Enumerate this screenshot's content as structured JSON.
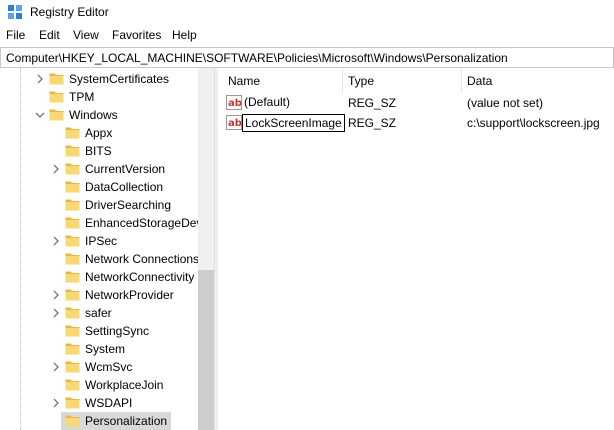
{
  "window": {
    "title": "Registry Editor",
    "app_icon": "registry-editor-icon"
  },
  "menu": [
    "File",
    "Edit",
    "View",
    "Favorites",
    "Help"
  ],
  "address": {
    "path": "Computer\\HKEY_LOCAL_MACHINE\\SOFTWARE\\Policies\\Microsoft\\Windows\\Personalization"
  },
  "tree": {
    "items": [
      {
        "label": "SystemCertificates",
        "expander": "collapsed"
      },
      {
        "label": "TPM",
        "expander": "none"
      },
      {
        "label": "Windows",
        "expander": "expanded"
      },
      {
        "label": "Appx",
        "expander": "none"
      },
      {
        "label": "BITS",
        "expander": "none"
      },
      {
        "label": "CurrentVersion",
        "expander": "collapsed"
      },
      {
        "label": "DataCollection",
        "expander": "none"
      },
      {
        "label": "DriverSearching",
        "expander": "none"
      },
      {
        "label": "EnhancedStorageDev",
        "expander": "none"
      },
      {
        "label": "IPSec",
        "expander": "collapsed"
      },
      {
        "label": "Network Connections",
        "expander": "none"
      },
      {
        "label": "NetworkConnectivity",
        "expander": "none"
      },
      {
        "label": "NetworkProvider",
        "expander": "collapsed"
      },
      {
        "label": "safer",
        "expander": "collapsed"
      },
      {
        "label": "SettingSync",
        "expander": "none"
      },
      {
        "label": "System",
        "expander": "none"
      },
      {
        "label": "WcmSvc",
        "expander": "collapsed"
      },
      {
        "label": "WorkplaceJoin",
        "expander": "none"
      },
      {
        "label": "WSDAPI",
        "expander": "collapsed"
      },
      {
        "label": "Personalization",
        "expander": "none",
        "selected": true
      }
    ]
  },
  "list": {
    "columns": {
      "name": "Name",
      "type": "Type",
      "data": "Data"
    },
    "rows": [
      {
        "name": "(Default)",
        "type": "REG_SZ",
        "data": "(value not set)",
        "icon": "string-value-icon"
      },
      {
        "name": "LockScreenImage",
        "type": "REG_SZ",
        "data": "c:\\support\\lockscreen.jpg",
        "icon": "string-value-icon",
        "focused": true
      }
    ]
  },
  "colors": {
    "folder": "#f8d775",
    "folder_dark": "#e3b844",
    "selection": "#d9d9d9",
    "ab_icon_red": "#c0392b"
  }
}
